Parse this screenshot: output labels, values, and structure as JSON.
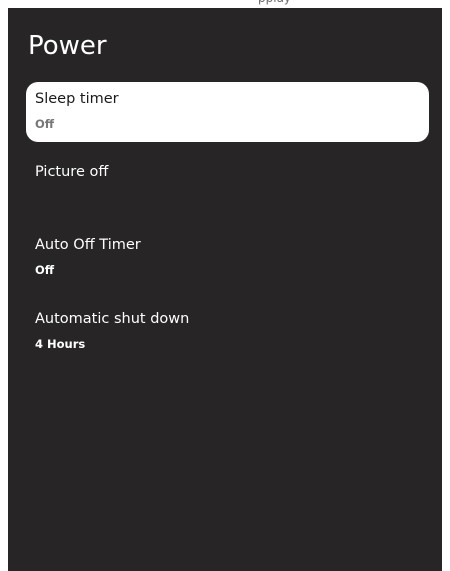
{
  "topbar": {
    "fragment": "pplay"
  },
  "page": {
    "title": "Power"
  },
  "items": [
    {
      "label": "Sleep timer",
      "value": "Off",
      "focused": true
    },
    {
      "label": "Picture off",
      "value": "",
      "focused": false
    },
    {
      "label": "Auto Off Timer",
      "value": "Off",
      "focused": false
    },
    {
      "label": "Automatic shut down",
      "value": "4 Hours",
      "focused": false
    }
  ],
  "colors": {
    "panel_background": "#272525",
    "focused_item_background": "#ffffff",
    "text_primary": "#ffffff",
    "focused_label": "#1a1a1a",
    "focused_value": "#777777"
  }
}
